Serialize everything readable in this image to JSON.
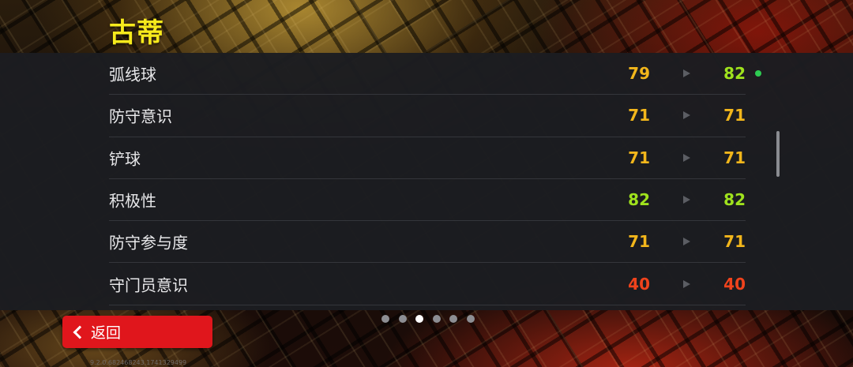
{
  "player": {
    "name": "古蒂"
  },
  "stats": [
    {
      "label": "弧线球",
      "old": "79",
      "new": "82",
      "old_color": "#f2b61b",
      "new_color": "#9fe21d",
      "changed": true,
      "dot_color": "#2ecc52"
    },
    {
      "label": "防守意识",
      "old": "71",
      "new": "71",
      "old_color": "#f2b61b",
      "new_color": "#f2b61b",
      "changed": false
    },
    {
      "label": "铲球",
      "old": "71",
      "new": "71",
      "old_color": "#f2b61b",
      "new_color": "#f2b61b",
      "changed": false
    },
    {
      "label": "积极性",
      "old": "82",
      "new": "82",
      "old_color": "#9fe21d",
      "new_color": "#9fe21d",
      "changed": false
    },
    {
      "label": "防守参与度",
      "old": "71",
      "new": "71",
      "old_color": "#f2b61b",
      "new_color": "#f2b61b",
      "changed": false
    },
    {
      "label": "守门员意识",
      "old": "40",
      "new": "40",
      "old_color": "#f0431c",
      "new_color": "#f0431c",
      "changed": false
    }
  ],
  "pager": {
    "count": 6,
    "active_index": 2
  },
  "back_button": {
    "label": "返回",
    "icon": "chevron-left-icon"
  },
  "version": "9.2.0.682468243.1741329499"
}
